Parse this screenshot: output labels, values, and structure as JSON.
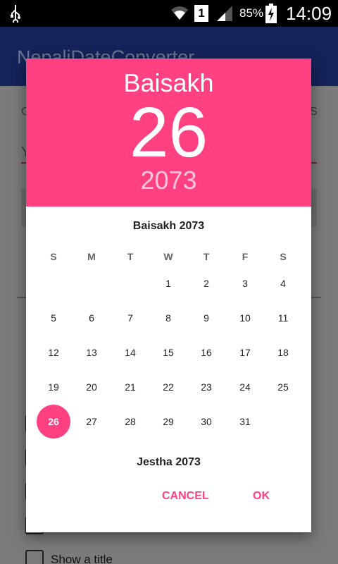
{
  "status_bar": {
    "sim_slot": "1",
    "battery": "85%",
    "time": "14:09",
    "icons": [
      "usb-icon",
      "wifi-icon",
      "sim-icon",
      "signal-icon",
      "battery-charging-icon"
    ]
  },
  "background_app": {
    "title": "NepaliDateConverter",
    "tab_left": "G",
    "tab_right": "S",
    "input_left": "Y",
    "checkbox_label": "Show a title"
  },
  "dialog": {
    "header": {
      "month": "Baisakh",
      "day": "26",
      "year": "2073"
    },
    "calendar": {
      "title": "Baisakh 2073",
      "weekdays": [
        "S",
        "M",
        "T",
        "W",
        "T",
        "F",
        "S"
      ],
      "first_weekday_index": 3,
      "days_in_month": 31,
      "selected_day": 26
    },
    "next_month_title": "Jestha 2073",
    "buttons": {
      "cancel": "CANCEL",
      "ok": "OK"
    }
  },
  "colors": {
    "accent": "#ff4081",
    "appbar": "#14235a"
  }
}
